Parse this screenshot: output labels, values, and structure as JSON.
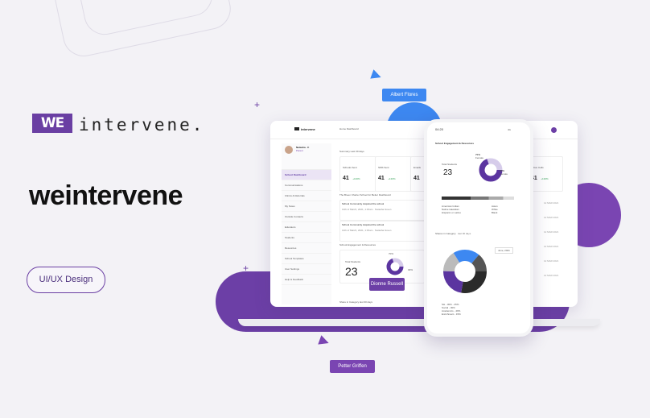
{
  "brand_logo_text": "WE",
  "logo_word": "intervene.",
  "brand_name": "weintervene",
  "tag_label": "UI/UX Design",
  "bubbles": {
    "top": "Albert Flores",
    "middle": "Dionne Russell",
    "bottom": "Petter Griffen"
  },
  "colors": {
    "purple": "#6c3fa6",
    "blue": "#3d88f1"
  },
  "laptop": {
    "logo": "intervene",
    "breadcrumb": "Home  Dashboard",
    "user_name": "Natasha . C",
    "user_role": "Parent",
    "summary_label": "Summary   Last 30 days",
    "sidebar": [
      "School Dashboard",
      "Communications",
      "Clinics & Referrals",
      "My Notes",
      "Outside Contacts",
      "Educators",
      "Students",
      "Resources",
      "School Templates",
      "User Settings",
      "Help & Feedback"
    ],
    "stats": [
      {
        "label": "Schools Sent",
        "value": "41",
        "delta": "+130%"
      },
      {
        "label": "SMS Sent",
        "value": "41",
        "delta": "+130%"
      },
      {
        "label": "Emails",
        "value": "41",
        "delta": "+130%"
      }
    ],
    "right_stat": {
      "label": "Active Cells",
      "value": "41",
      "delta": "+130%"
    },
    "recent_title": "The Breen Charter School for Better Dashboard",
    "recent_items": [
      {
        "title": "School Community Acquired the school",
        "date": "13th of March, 2021, 1:15am",
        "author": "Natasha Green"
      },
      {
        "title": "School Community Acquired the school",
        "date": "13th of March, 2021, 1:15am",
        "author": "Natasha Green"
      }
    ],
    "engagement_title": "School Engagement & Resources",
    "total_students_label": "Total Students",
    "total_students": "23",
    "donut_a": "70%",
    "donut_b": "30%",
    "shares_label": "Share in Category   last 30 days",
    "right_dates": [
      "12 MAR 2021",
      "12 MAR 2021",
      "12 MAR 2021",
      "12 MAR 2021",
      "12 MAR 2021",
      "12 MAR 2021"
    ]
  },
  "phone": {
    "time": "04:20",
    "signal": "4G",
    "section_title": "School Engagement & Resources",
    "total_students_label": "Total Students",
    "total_students": "23",
    "donut_a": "70%",
    "donut_a_sub": "Female",
    "donut_b": "30%",
    "donut_b_sub": "Female",
    "legend": [
      "American Indian",
      "Asian",
      "Native Hawaiian",
      "White",
      "Hispanic or Latino",
      "Black"
    ],
    "share_title": "Shares in Category",
    "share_range": "last 30 days",
    "date_badge": "June, 2021",
    "pie_legend": [
      "SH - 30% - 25%",
      "Social - 30%",
      "Academics - 40%",
      "Enrichment - 15%"
    ]
  }
}
